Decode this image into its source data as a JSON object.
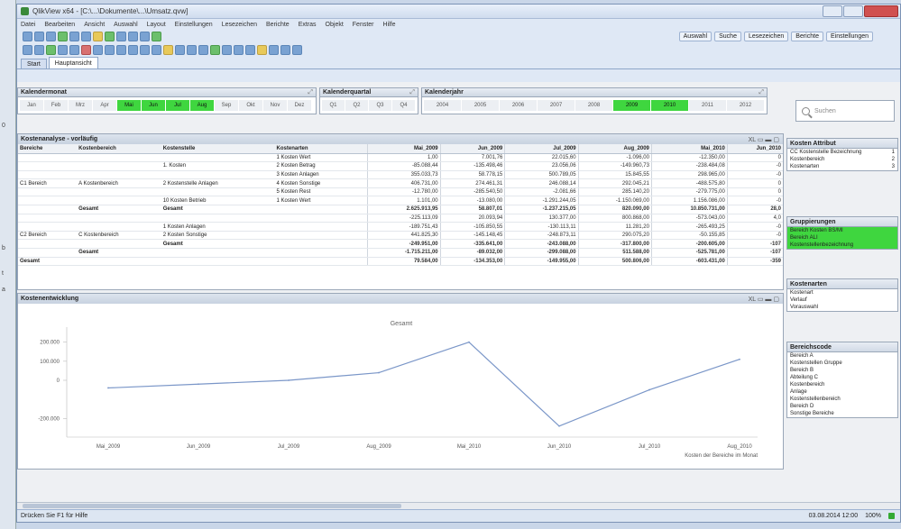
{
  "window": {
    "title": "QlikView x64 - [C:\\...\\Dokumente\\...\\Umsatz.qvw]"
  },
  "menu": [
    "Datei",
    "Bearbeiten",
    "Ansicht",
    "Auswahl",
    "Layout",
    "Einstellungen",
    "Lesezeichen",
    "Berichte",
    "Extras",
    "Objekt",
    "Fenster",
    "Hilfe"
  ],
  "toolbar": {
    "right": [
      "Auswahl",
      "Suche",
      "Lesezeichen",
      "Berichte",
      "Einstellungen"
    ]
  },
  "tabs": [
    "Start",
    "Hauptansicht"
  ],
  "filters": {
    "monat": {
      "title": "Kalendermonat",
      "items": [
        "Jan",
        "Feb",
        "Mrz",
        "Apr",
        "Mai",
        "Jun",
        "Jul",
        "Aug",
        "Sep",
        "Okt",
        "Nov",
        "Dez"
      ],
      "selected": [
        4,
        5,
        6,
        7
      ]
    },
    "quartal": {
      "title": "Kalenderquartal",
      "items": [
        "Q1",
        "Q2",
        "Q3",
        "Q4"
      ]
    },
    "jahr": {
      "title": "Kalenderjahr",
      "items": [
        "2004",
        "2005",
        "2006",
        "2007",
        "2008",
        "2009",
        "2010",
        "2011",
        "2012"
      ],
      "selected": [
        5,
        6
      ]
    }
  },
  "search": {
    "placeholder": "Suchen"
  },
  "pivot": {
    "title": "Kostenanalyse - vorläufig",
    "headers": [
      "Bereiche",
      "Kostenbereich",
      "Kostenstelle",
      "Kostenarten",
      "Mai_2009",
      "Jun_2009",
      "Jul_2009",
      "Aug_2009",
      "Mai_2010",
      "Jun_2010"
    ],
    "rows": [
      {
        "c1": "",
        "c2": "",
        "c3": "",
        "c4": "1 Kosten Wert",
        "v": [
          "1,00",
          "7.001,76",
          "22.015,60",
          "-1.096,00",
          "-12.350,00",
          "0"
        ]
      },
      {
        "c1": "",
        "c2": "",
        "c3": "1. Kosten",
        "c4": "2 Kosten Betrag",
        "v": [
          "-85.088,44",
          "-135.498,46",
          "23.056,06",
          "-149.960,73",
          "-238.484,08",
          "-0"
        ]
      },
      {
        "c1": "",
        "c2": "",
        "c3": "",
        "c4": "3 Kosten Anlagen",
        "v": [
          "355.033,73",
          "58.778,15",
          "500.789,05",
          "15.845,55",
          "298.965,00",
          "-0"
        ]
      },
      {
        "c1": "C1 Bereich",
        "c2": "A Kostenbereich",
        "c3": "2 Kostenstelle Anlagen",
        "c4": "4 Kosten Sonstige",
        "v": [
          "406.731,00",
          "274.461,31",
          "246.088,14",
          "292.045,21",
          "-488.575,80",
          "0"
        ]
      },
      {
        "c1": "",
        "c2": "",
        "c3": "",
        "c4": "5 Kosten Rest",
        "v": [
          "-12.780,00",
          "-285.540,50",
          "-2.081,66",
          "285.140,20",
          "-279.775,00",
          "0"
        ]
      },
      {
        "c1": "",
        "c2": "",
        "c3": "10 Kosten Betrieb",
        "c4": "1 Kosten Wert",
        "v": [
          "1.101,00",
          "-13.080,00",
          "-1.291.244,05",
          "-1.150.069,00",
          "1.156.086,00",
          "-0"
        ]
      },
      {
        "c1": "",
        "c2": "Gesamt",
        "c3": "Gesamt",
        "c4": "",
        "v": [
          "2.625.913,95",
          "58.807,01",
          "-1.237.215,05",
          "820.090,00",
          "10.850.731,00",
          "28,0"
        ],
        "sum": true
      },
      {
        "c1": "",
        "c2": "",
        "c3": "",
        "c4": "",
        "v": [
          "-225.113,09",
          "20.093,94",
          "130.377,00",
          "800.868,00",
          "-573.043,00",
          "4,0"
        ]
      },
      {
        "c1": "",
        "c2": "",
        "c3": "1 Kosten Anlagen",
        "c4": "",
        "v": [
          "-189.751,43",
          "-105.850,55",
          "-130.113,11",
          "11.281,20",
          "-265.493,25",
          "-0"
        ]
      },
      {
        "c1": "C2 Bereich",
        "c2": "C Kostenbereich",
        "c3": "2 Kosten Sonstige",
        "c4": "",
        "v": [
          "441.825,30",
          "-145.148,45",
          "-248.873,11",
          "290.075,20",
          "-50.155,85",
          "-0"
        ]
      },
      {
        "c1": "",
        "c2": "",
        "c3": "Gesamt",
        "c4": "",
        "v": [
          "-249.951,00",
          "-335.641,00",
          "-243.088,00",
          "-317.800,00",
          "-200.605,00",
          "-107"
        ],
        "sum": true
      },
      {
        "c1": "",
        "c2": "Gesamt",
        "c3": "",
        "c4": "",
        "v": [
          "-1.715.211,00",
          "-89.032,00",
          "-299.088,00",
          "511.588,00",
          "-525.781,00",
          "-107"
        ],
        "sum": true
      },
      {
        "c1": "Gesamt",
        "c2": "",
        "c3": "",
        "c4": "",
        "v": [
          "79.584,00",
          "-134.353,00",
          "-149.955,00",
          "500.806,00",
          "-603.431,00",
          "-359"
        ],
        "sum": true
      }
    ]
  },
  "chart_data": {
    "type": "line",
    "panel_title": "Kostenentwicklung",
    "title": "Gesamt",
    "categories": [
      "Mai_2009",
      "Jun_2009",
      "Jul_2009",
      "Aug_2009",
      "Mai_2010",
      "Jun_2010",
      "Jul_2010",
      "Aug_2010"
    ],
    "values": [
      -40000,
      -20000,
      0,
      40000,
      200000,
      -240000,
      -50000,
      110000
    ],
    "yticks": [
      "200.000",
      "100.000",
      "0",
      "-200.000"
    ],
    "ylim": [
      -260000,
      260000
    ],
    "xlabel": "Kosten der Bereiche im Monat",
    "color": "#7a96c8"
  },
  "right": {
    "box1": {
      "title": "Kosten Attribut",
      "items": [
        {
          "l": "CC Kostenstelle Bezeichnung",
          "v": "1"
        },
        {
          "l": "Kostenbereich",
          "v": "2"
        },
        {
          "l": "Kostenarten",
          "v": "3"
        }
      ]
    },
    "box2": {
      "title": "Gruppierungen",
      "items": [
        {
          "l": "Bereich Kosten BS/MI",
          "sel": true
        },
        {
          "l": "Bereich ALI",
          "sel": true
        },
        {
          "l": "Kostenstellenbezeichnung",
          "sel": true
        }
      ]
    },
    "box3": {
      "title": "Kostenarten",
      "items": [
        {
          "l": "Kostenart"
        },
        {
          "l": "Verlauf"
        },
        {
          "l": "Vorauswahl"
        }
      ]
    },
    "box4": {
      "title": "Bereichscode",
      "items": [
        {
          "l": "Bereich A"
        },
        {
          "l": "Kostenstellen Gruppe"
        },
        {
          "l": "Bereich B"
        },
        {
          "l": "Abteilung C"
        },
        {
          "l": "Kostenbereich"
        },
        {
          "l": "Anlage"
        },
        {
          "l": "Kostenstellenbereich"
        },
        {
          "l": "Bereich D"
        },
        {
          "l": "Sonstige Bereiche"
        }
      ]
    }
  },
  "status": {
    "left": "Drücken Sie F1 für Hilfe",
    "date": "03.08.2014 12:00",
    "zoom": "100%"
  }
}
